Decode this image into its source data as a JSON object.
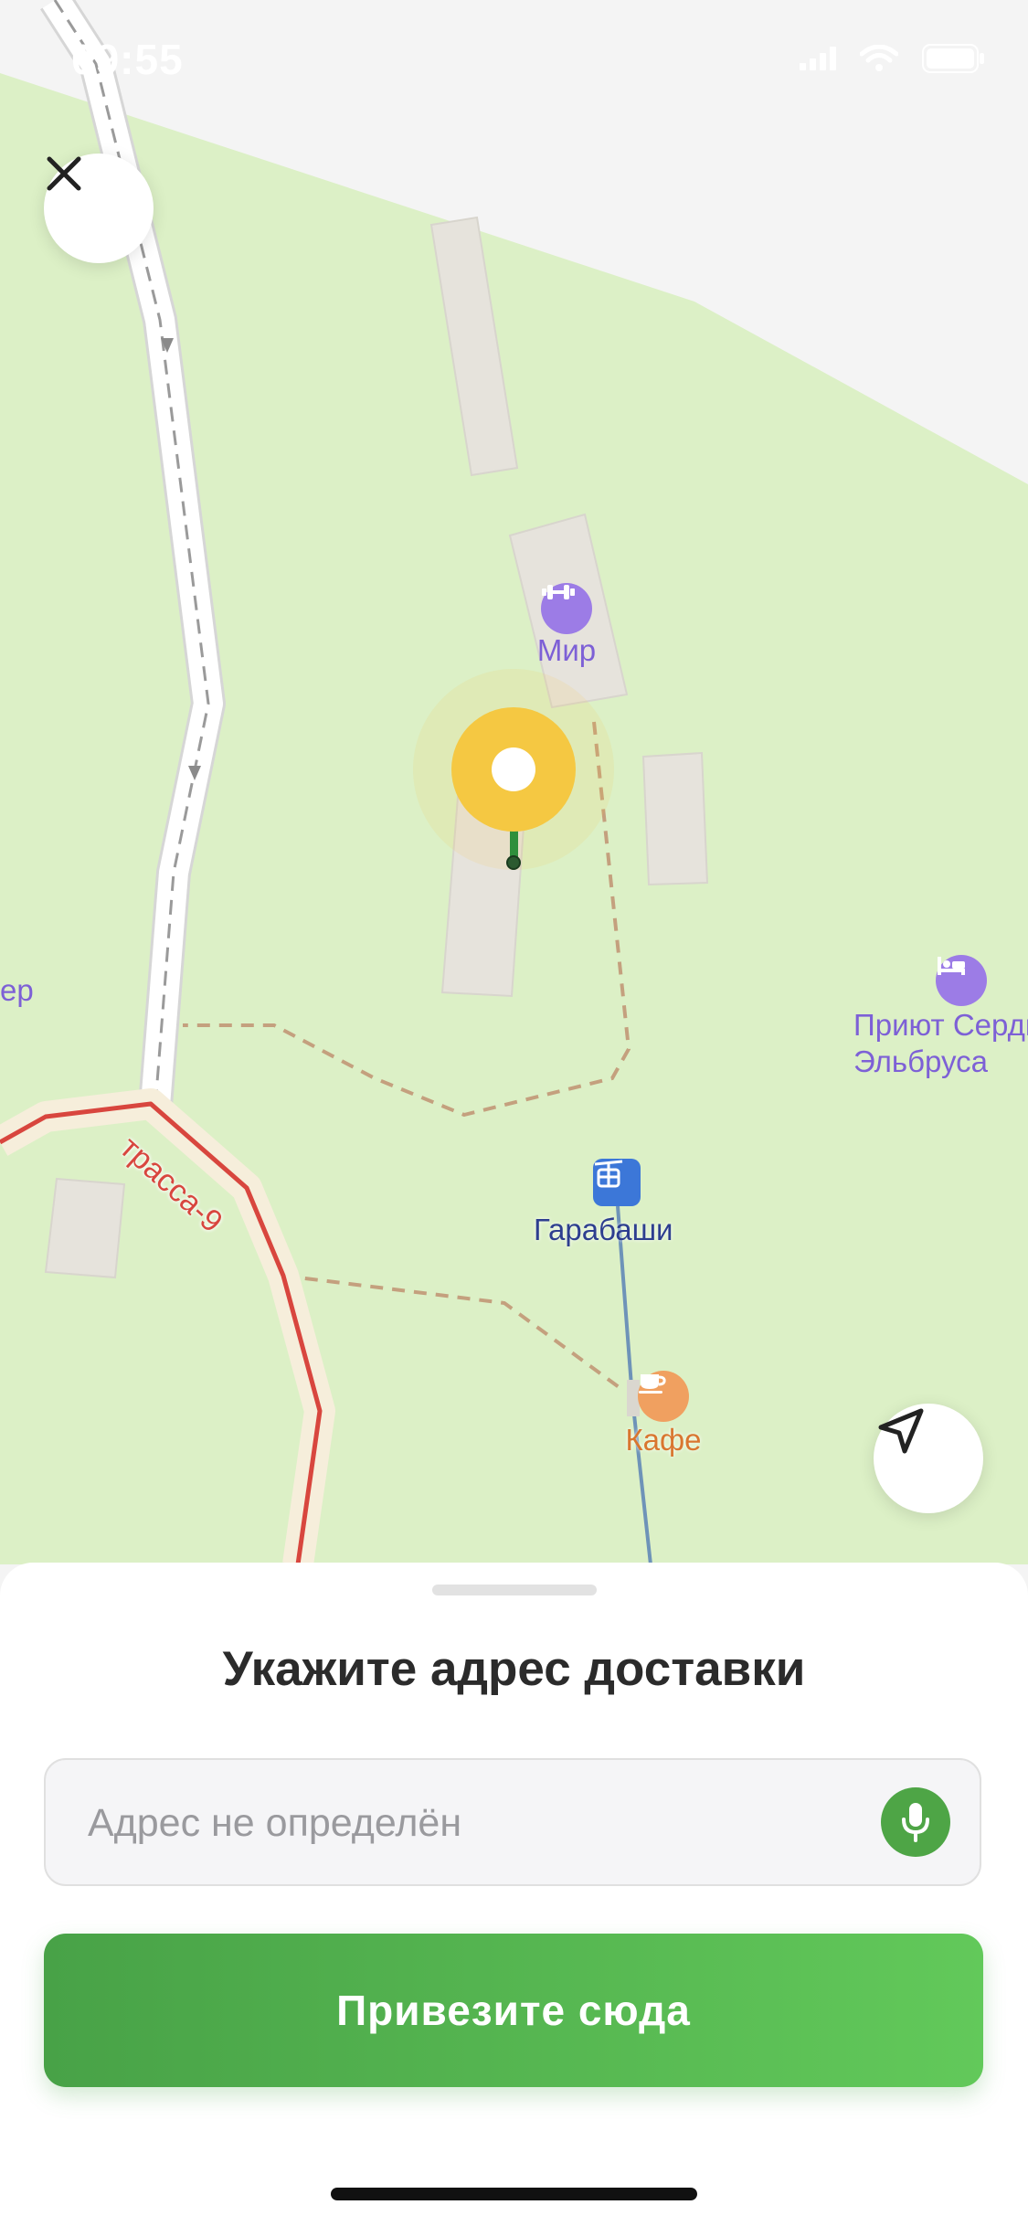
{
  "status_bar": {
    "time": "09:55"
  },
  "map": {
    "pois": {
      "mir": {
        "label": "Мир",
        "icon": "fitness-icon"
      },
      "shelter": {
        "label": "Приют Сердце\nЭльбруса",
        "icon": "hotel-icon"
      },
      "left_cut": {
        "label": "ер"
      },
      "garabashi": {
        "label": "Гарабаши",
        "icon": "cable-car-icon"
      },
      "cafe": {
        "label": "Кафе",
        "icon": "cafe-icon"
      }
    },
    "road_label": "трасса-9",
    "colors": {
      "meadow": "#dcf0c6",
      "snow": "#f4f4f4",
      "pin": "#f5c842",
      "road_red": "#d8463e"
    }
  },
  "sheet": {
    "title": "Укажите адрес доставки",
    "address_placeholder": "Адрес не определён",
    "address_value": "",
    "button_label": "Привезите сюда"
  },
  "colors": {
    "accent_green": "#4ea546"
  }
}
